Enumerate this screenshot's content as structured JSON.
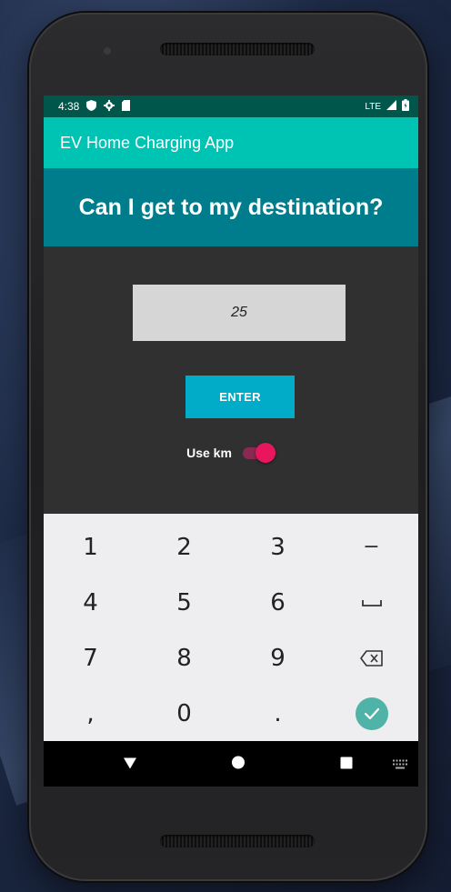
{
  "status_bar": {
    "time": "4:38",
    "network": "LTE",
    "icons": [
      "shield-icon",
      "gear-icon",
      "sd-card-icon",
      "signal-icon",
      "battery-icon"
    ]
  },
  "app_bar": {
    "title": "EV Home Charging App"
  },
  "banner": {
    "text": "Can I get to my destination?"
  },
  "distance_input": {
    "value": "25"
  },
  "enter_button": {
    "label": "ENTER"
  },
  "units_switch": {
    "label": "Use km",
    "checked": true
  },
  "keyboard": {
    "keys": [
      "1",
      "2",
      "3",
      "−",
      "4",
      "5",
      "6",
      "space",
      "7",
      "8",
      "9",
      "backspace",
      ",",
      "0",
      ".",
      "done"
    ],
    "labels": {
      "k1": "1",
      "k2": "2",
      "k3": "3",
      "minus": "−",
      "k4": "4",
      "k5": "5",
      "k6": "6",
      "space": "⎵",
      "k7": "7",
      "k8": "8",
      "k9": "9",
      "comma": ",",
      "k0": "0",
      "period": "."
    }
  },
  "nav_bar": {
    "icons": [
      "back-icon",
      "home-icon",
      "recents-icon",
      "keyboard-icon"
    ]
  },
  "colors": {
    "status_bar": "#00564a",
    "app_bar": "#00c4b3",
    "banner": "#007d8c",
    "background": "#303030",
    "enter_button": "#00acc8",
    "switch_thumb": "#e8175d",
    "done_key": "#4fb3a8"
  }
}
